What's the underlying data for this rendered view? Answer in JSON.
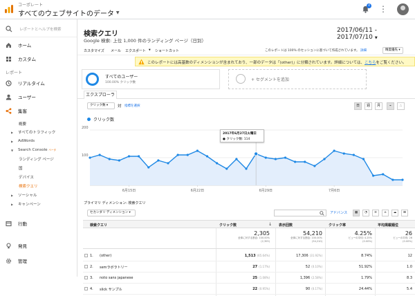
{
  "app": {
    "org": "コーポレート",
    "property": "すべてのウェブサイトのデータ",
    "notification_count": "4"
  },
  "sidebar": {
    "search_placeholder": "レポートとヘルプを検索",
    "home": "ホーム",
    "custom": "カスタム",
    "reports_section": "レポート",
    "realtime": "リアルタイム",
    "audience": "ユーザー",
    "acquisition": "集客",
    "overview": "概要",
    "all_traffic": "すべてのトラフィック",
    "adwords": "AdWords",
    "search_console": "Search Console",
    "beta": "ベータ",
    "landing_pages": "ランディング ページ",
    "countries": "国",
    "devices": "デバイス",
    "queries": "検索クエリ",
    "social": "ソーシャル",
    "campaigns": "キャンペーン",
    "behavior": "行動",
    "discover": "発見",
    "admin": "管理"
  },
  "report": {
    "title": "検索クエリ",
    "subtitle": "Google 検索: 上位 1,000 件のランディング ページ（日別）",
    "date_range": "2017/06/11 - 2017/07/10"
  },
  "toolbar": {
    "customize": "カスタマイズ",
    "email": "メール",
    "export": "エクスポート",
    "shortcut": "ショートカット",
    "note": "このレポートは 100% のセッションに基づいて作成されています。",
    "detail": "詳細",
    "quality": "精度優先"
  },
  "notice": {
    "text": "このレポートには高基数のディメンションが含まれており、一部のデータは「(other)」に分類されています。詳細については、",
    "link": "こちら",
    "tail": "をご覧ください。"
  },
  "segments": {
    "all_users": "すべてのユーザー",
    "all_users_pct": "100.00% クリック数",
    "add_segment": "+ セグメントを追加"
  },
  "tabs": {
    "explorer": "エクスプローラ"
  },
  "chart_controls": {
    "metric": "クリック数",
    "vs": "対",
    "pick": "指標を選択",
    "day": "日",
    "week": "週",
    "month": "月"
  },
  "chart_data": {
    "type": "line",
    "series": [
      {
        "name": "クリック数",
        "values": [
          100,
          110,
          95,
          90,
          105,
          105,
          65,
          90,
          80,
          110,
          110,
          125,
          105,
          80,
          60,
          95,
          60,
          114,
          100,
          95,
          100,
          85,
          85,
          70,
          95,
          125,
          115,
          110,
          95,
          35,
          40,
          20,
          20
        ]
      }
    ],
    "x_tick_labels": [
      "6月15日",
      "6月22日",
      "6月29日",
      "7月6日"
    ],
    "ylim": [
      0,
      200
    ],
    "y_ticks": [
      100,
      200
    ],
    "grid": true,
    "legend": "top-left"
  },
  "tooltip": {
    "date": "2017年6月27日火曜日",
    "value": "● クリック数: 114"
  },
  "dimension": {
    "label": "プライマリ ディメンション:",
    "value": "検索クエリ",
    "secondary": "セカンダリ ディメンション",
    "advanced": "アドバンス"
  },
  "table": {
    "headers": {
      "query": "検索クエリ",
      "clicks": "クリック数",
      "impressions": "表示回数",
      "ctr": "クリック率",
      "position": "平均掲載順位"
    },
    "totals": {
      "clicks": "2,305",
      "clicks_sub": "全体に対する割合: 100.00%",
      "clicks_sub2": "(2,305)",
      "impressions": "54,210",
      "impressions_sub": "全体に対する割合: 100.00%",
      "impressions_sub2": "(54,210)",
      "ctr": "4.25%",
      "ctr_sub": "ビューの平均: 4.25%",
      "ctr_sub2": "(0.00%)",
      "position": "26",
      "position_sub": "ビューの平均: 26",
      "position_sub2": "(0.00%)"
    },
    "rows": [
      {
        "i": "1.",
        "q": "(other)",
        "clicks": "1,513",
        "clicks_pct": "(65.64%)",
        "imp": "17,306",
        "imp_pct": "(31.92%)",
        "ctr": "8.74%",
        "pos": "12"
      },
      {
        "i": "2.",
        "q": "semラボラトリー",
        "clicks": "27",
        "clicks_pct": "(1.17%)",
        "imp": "52",
        "imp_pct": "(0.10%)",
        "ctr": "51.92%",
        "pos": "1.0"
      },
      {
        "i": "3.",
        "q": "noto sans japanese",
        "clicks": "25",
        "clicks_pct": "(1.08%)",
        "imp": "1,396",
        "imp_pct": "(2.58%)",
        "ctr": "1.79%",
        "pos": "8.3"
      },
      {
        "i": "4.",
        "q": "slick サンプル",
        "clicks": "22",
        "clicks_pct": "(0.95%)",
        "imp": "90",
        "imp_pct": "(0.17%)",
        "ctr": "24.44%",
        "pos": "5.4"
      }
    ]
  }
}
